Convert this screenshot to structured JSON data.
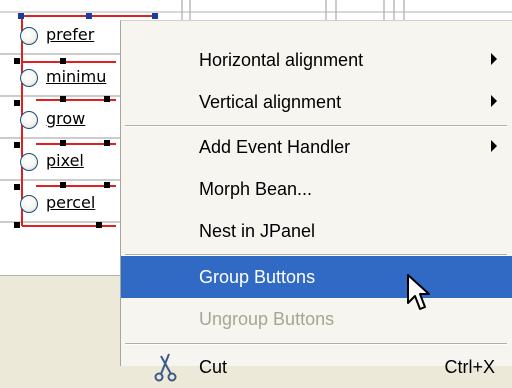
{
  "radio_buttons": [
    {
      "label": "prefer"
    },
    {
      "label": "minimu"
    },
    {
      "label": "grow"
    },
    {
      "label": "pixel"
    },
    {
      "label": "percel"
    }
  ],
  "context_menu": {
    "items": [
      {
        "label": "Horizontal alignment",
        "submenu": true
      },
      {
        "label": "Vertical alignment",
        "submenu": true
      },
      {
        "label": "Add Event Handler",
        "submenu": true
      },
      {
        "label": "Morph Bean..."
      },
      {
        "label": "Nest in JPanel"
      },
      {
        "label": "Group Buttons",
        "state": "selected"
      },
      {
        "label": "Ungroup Buttons",
        "state": "disabled"
      },
      {
        "label": "Cut",
        "shortcut": "Ctrl+X"
      }
    ]
  },
  "colors": {
    "selection": "#316ac5",
    "disabled_text": "#a8a596",
    "selection_outline": "#e02020",
    "handle_blue": "#1a3c9c"
  },
  "icons": [
    "cut-icon",
    "submenu-arrow-icon",
    "mouse-pointer-icon",
    "radio-icon"
  ]
}
